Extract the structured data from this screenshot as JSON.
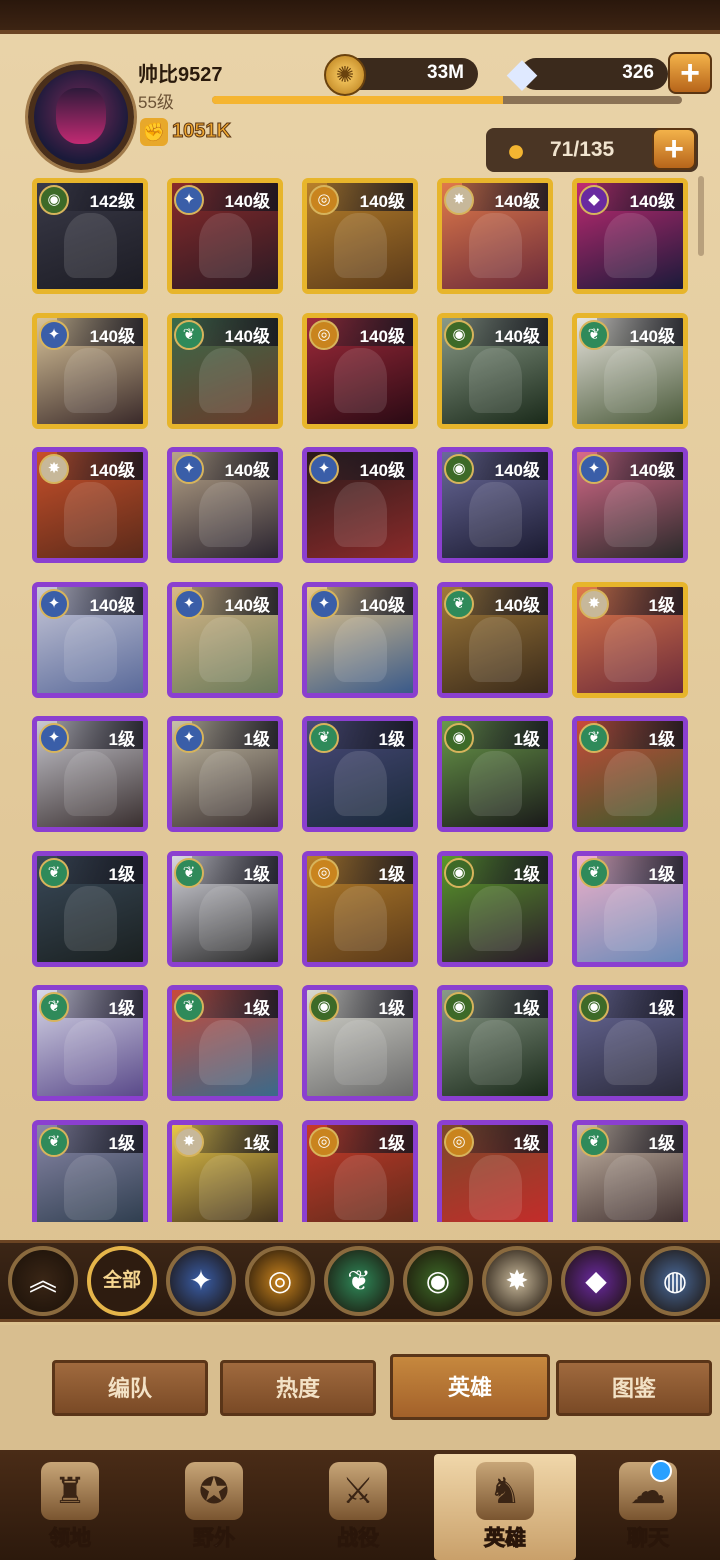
{
  "player": {
    "name": "帅比9527",
    "level": "55级",
    "xp_progress": 0.62,
    "power": "1051K"
  },
  "resources": {
    "gold": "33M",
    "gems": "326"
  },
  "roster": {
    "count": "71/135"
  },
  "factions": {
    "lightbearer": {
      "icon": "✦",
      "color": "#3a5ea8"
    },
    "mauler": {
      "icon": "◎",
      "color": "#c9841e"
    },
    "wilder": {
      "icon": "❦",
      "color": "#2f8a5a"
    },
    "graveborn": {
      "icon": "◉",
      "color": "#3d6a28"
    },
    "celestial": {
      "icon": "✸",
      "color": "#c7b89a"
    },
    "hypogean": {
      "icon": "◆",
      "color": "#6a2aa0"
    }
  },
  "heroes": [
    {
      "level": "142级",
      "frame": "gold",
      "faction": "graveborn",
      "art": [
        "#3a3a48",
        "#1c1c24"
      ]
    },
    {
      "level": "140级",
      "frame": "gold",
      "faction": "lightbearer",
      "art": [
        "#8a2a2a",
        "#2a1a24"
      ]
    },
    {
      "level": "140级",
      "frame": "gold",
      "faction": "mauler",
      "art": [
        "#b8802a",
        "#5a3a1a"
      ]
    },
    {
      "level": "140级",
      "frame": "gold",
      "faction": "celestial",
      "art": [
        "#e07a4a",
        "#6a2a3a"
      ]
    },
    {
      "level": "140级",
      "frame": "gold",
      "faction": "hypogean",
      "art": [
        "#c22a72",
        "#1a1a3a"
      ]
    },
    {
      "level": "140级",
      "frame": "gold",
      "faction": "lightbearer",
      "art": [
        "#d9c49a",
        "#3a2a2a"
      ]
    },
    {
      "level": "140级",
      "frame": "gold",
      "faction": "wilder",
      "art": [
        "#3a6a4a",
        "#6a3a2a"
      ]
    },
    {
      "level": "140级",
      "frame": "gold",
      "faction": "mauler",
      "art": [
        "#a02a3a",
        "#2a0a14"
      ]
    },
    {
      "level": "140级",
      "frame": "gold",
      "faction": "graveborn",
      "art": [
        "#8a9a88",
        "#1a2a1a"
      ]
    },
    {
      "level": "140级",
      "frame": "gold",
      "faction": "wilder",
      "art": [
        "#e8e4de",
        "#4a5a3a"
      ]
    },
    {
      "level": "140级",
      "frame": "purple",
      "faction": "celestial",
      "art": [
        "#c8502a",
        "#5a2a1a"
      ]
    },
    {
      "level": "140级",
      "frame": "purple",
      "faction": "lightbearer",
      "art": [
        "#b8a488",
        "#2a2430"
      ]
    },
    {
      "level": "140级",
      "frame": "purple",
      "faction": "lightbearer",
      "art": [
        "#2a1a1a",
        "#8a2a2a"
      ]
    },
    {
      "level": "140级",
      "frame": "purple",
      "faction": "graveborn",
      "art": [
        "#6a6a9a",
        "#1a1a30"
      ]
    },
    {
      "level": "140级",
      "frame": "purple",
      "faction": "lightbearer",
      "art": [
        "#d86a8a",
        "#2a2a2a"
      ]
    },
    {
      "level": "140级",
      "frame": "purple",
      "faction": "lightbearer",
      "art": [
        "#c8c8d8",
        "#5a6a9a"
      ]
    },
    {
      "level": "140级",
      "frame": "purple",
      "faction": "lightbearer",
      "art": [
        "#d8b888",
        "#6a7a5a"
      ]
    },
    {
      "level": "140级",
      "frame": "purple",
      "faction": "lightbearer",
      "art": [
        "#e8c88a",
        "#3a5a8a"
      ]
    },
    {
      "level": "140级",
      "frame": "purple",
      "faction": "wilder",
      "art": [
        "#a07a3a",
        "#3a2a1a"
      ]
    },
    {
      "level": "1级",
      "frame": "gold",
      "faction": "celestial",
      "art": [
        "#e07a4a",
        "#6a2a3a"
      ]
    },
    {
      "level": "1级",
      "frame": "purple",
      "faction": "lightbearer",
      "art": [
        "#c8c8d0",
        "#3a3030"
      ]
    },
    {
      "level": "1级",
      "frame": "purple",
      "faction": "lightbearer",
      "art": [
        "#c8c0a8",
        "#3a3030"
      ]
    },
    {
      "level": "1级",
      "frame": "purple",
      "faction": "wilder",
      "art": [
        "#4a4a7a",
        "#1a2a3a"
      ]
    },
    {
      "level": "1级",
      "frame": "purple",
      "faction": "graveborn",
      "art": [
        "#6a9a4a",
        "#1a1a1a"
      ]
    },
    {
      "level": "1级",
      "frame": "purple",
      "faction": "wilder",
      "art": [
        "#c84a3a",
        "#3a5a2a"
      ]
    },
    {
      "level": "1级",
      "frame": "purple",
      "faction": "wilder",
      "art": [
        "#3a4a5a",
        "#1a2020"
      ]
    },
    {
      "level": "1级",
      "frame": "purple",
      "faction": "wilder",
      "art": [
        "#d8d8e0",
        "#2a2a2a"
      ]
    },
    {
      "level": "1级",
      "frame": "purple",
      "faction": "mauler",
      "art": [
        "#b8802a",
        "#5a3a1a"
      ]
    },
    {
      "level": "1级",
      "frame": "purple",
      "faction": "graveborn",
      "art": [
        "#5a9a2a",
        "#2a1a2a"
      ]
    },
    {
      "level": "1级",
      "frame": "purple",
      "faction": "wilder",
      "art": [
        "#f0b0c8",
        "#6a8ab8"
      ]
    },
    {
      "level": "1级",
      "frame": "purple",
      "faction": "wilder",
      "art": [
        "#d8d8e8",
        "#5a4a8a"
      ]
    },
    {
      "level": "1级",
      "frame": "purple",
      "faction": "wilder",
      "art": [
        "#c84a3a",
        "#3a6a8a"
      ]
    },
    {
      "level": "1级",
      "frame": "purple",
      "faction": "graveborn",
      "art": [
        "#d8d8d0",
        "#6a6a6a"
      ]
    },
    {
      "level": "1级",
      "frame": "purple",
      "faction": "graveborn",
      "art": [
        "#8a9a88",
        "#1a2a1a"
      ]
    },
    {
      "level": "1级",
      "frame": "purple",
      "faction": "graveborn",
      "art": [
        "#6a6a9a",
        "#2a2a3a"
      ]
    },
    {
      "level": "1级",
      "frame": "purple",
      "faction": "wilder",
      "art": [
        "#8a88a8",
        "#2a3a4a"
      ]
    },
    {
      "level": "1级",
      "frame": "purple",
      "faction": "celestial",
      "art": [
        "#e8c84a",
        "#3a2a1a"
      ]
    },
    {
      "level": "1级",
      "frame": "purple",
      "faction": "mauler",
      "art": [
        "#c83a2a",
        "#5a2a1a"
      ]
    },
    {
      "level": "1级",
      "frame": "purple",
      "faction": "mauler",
      "art": [
        "#7a4a2a",
        "#c82a2a"
      ]
    },
    {
      "level": "1级",
      "frame": "purple",
      "faction": "wilder",
      "art": [
        "#c8b8a8",
        "#3a2a2a"
      ]
    }
  ],
  "filters": [
    {
      "name": "collapse",
      "icon": "︽",
      "color": "#3a2616"
    },
    {
      "name": "all",
      "label": "全部",
      "color": "#2e1c10"
    },
    {
      "name": "lightbearer",
      "icon": "✦",
      "color": "#3a5ea8"
    },
    {
      "name": "mauler",
      "icon": "◎",
      "color": "#c9841e"
    },
    {
      "name": "wilder",
      "icon": "❦",
      "color": "#2f8a5a"
    },
    {
      "name": "graveborn",
      "icon": "◉",
      "color": "#3d6a28"
    },
    {
      "name": "celestial",
      "icon": "✸",
      "color": "#c7b89a"
    },
    {
      "name": "hypogean",
      "icon": "◆",
      "color": "#6a2aa0"
    },
    {
      "name": "dimensional",
      "icon": "◍",
      "color": "#4a6a9a"
    }
  ],
  "subtabs": [
    {
      "label": "编队",
      "active": false
    },
    {
      "label": "热度",
      "active": false
    },
    {
      "label": "英雄",
      "active": true
    },
    {
      "label": "图鉴",
      "active": false
    }
  ],
  "nav": [
    {
      "label": "领地",
      "icon": "castle-icon",
      "glyph": "♜",
      "active": false
    },
    {
      "label": "野外",
      "icon": "map-scroll-icon",
      "glyph": "✪",
      "active": false
    },
    {
      "label": "战役",
      "icon": "sword-shield-icon",
      "glyph": "⚔",
      "active": false
    },
    {
      "label": "英雄",
      "icon": "helmet-icon",
      "glyph": "♞",
      "active": true
    },
    {
      "label": "聊天",
      "icon": "chat-icon",
      "glyph": "☁",
      "active": false
    }
  ]
}
